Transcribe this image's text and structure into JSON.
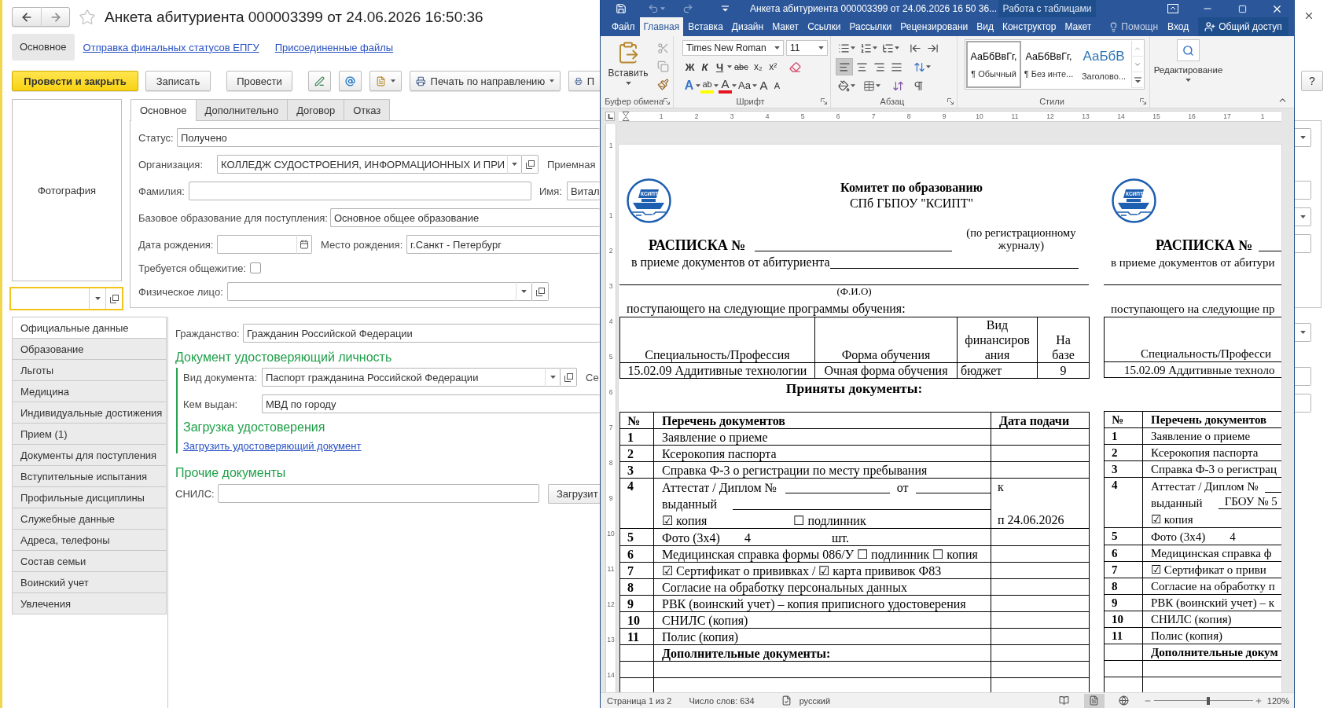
{
  "form": {
    "title": "Анкета абитуриента 000003399 от 24.06.2026 16:50:36",
    "sections": [
      {
        "label": "Основное",
        "selected": true
      },
      {
        "label": "Отправка финальных статусов ЕПГУ",
        "selected": false
      },
      {
        "label": "Присоединенные файлы",
        "selected": false
      }
    ],
    "toolbar": {
      "buttons": [
        {
          "kind": "primary",
          "label": "Провести и закрыть"
        },
        {
          "kind": "plain",
          "label": "Записать"
        },
        {
          "kind": "plain",
          "label": "Провести"
        }
      ],
      "print_buttons": [
        {
          "kind": "menu",
          "label": "Печать по направлению"
        },
        {
          "kind": "plain",
          "label": "П"
        }
      ]
    },
    "photo_label": "Фотография",
    "tabs": [
      {
        "label": "Основное",
        "selected": true
      },
      {
        "label": "Дополнительно",
        "selected": false
      },
      {
        "label": "Договор",
        "selected": false
      },
      {
        "label": "Отказ",
        "selected": false
      }
    ],
    "status": {
      "label": "Статус:",
      "value": "Получено"
    },
    "organization": {
      "label": "Организация:",
      "value": "КОЛЛЕДЖ СУДОСТРОЕНИЯ, ИНФОРМАЦИОННЫХ И ПРИ",
      "next_label": "Приемная"
    },
    "surname": {
      "label": "Фамилия:"
    },
    "first_name": {
      "label": "Имя:",
      "value": "Витал"
    },
    "base_education": {
      "label": "Базовое образование для поступления:",
      "value": "Основное общее образование"
    },
    "birth_date": {
      "label": "Дата рождения:"
    },
    "birth_place": {
      "label": "Место рождения:",
      "value": "г.Санкт - Петербург"
    },
    "dormitory": {
      "label": "Требуется общежитие:",
      "checked": false
    },
    "person": {
      "label": "Физическое лицо:"
    },
    "side_menu": [
      {
        "label": "Официальные данные",
        "selected": true
      },
      {
        "label": "Образование",
        "selected": false
      },
      {
        "label": "Льготы",
        "selected": false
      },
      {
        "label": "Медицина",
        "selected": false
      },
      {
        "label": "Индивидуальные достижения",
        "selected": false
      },
      {
        "label": "Прием (1)",
        "selected": false
      },
      {
        "label": "Документы для поступления",
        "selected": false
      },
      {
        "label": "Вступительные испытания",
        "selected": false
      },
      {
        "label": "Профильные дисциплины",
        "selected": false
      },
      {
        "label": "Служебные данные",
        "selected": false
      },
      {
        "label": "Адреса, телефоны",
        "selected": false
      },
      {
        "label": "Состав семьи",
        "selected": false
      },
      {
        "label": "Воинский учет",
        "selected": false
      },
      {
        "label": "Увлечения",
        "selected": false
      }
    ],
    "citizenship": {
      "label": "Гражданство:",
      "value": "Гражданин Российской Федерации"
    },
    "identity": {
      "title": "Документ удостоверяющий личность",
      "doc_type": {
        "label": "Вид документа:",
        "value": "Паспорт гражданина Российской Федерации",
        "next_label": "Се"
      },
      "issued_by": {
        "label": "Кем выдан:",
        "value": "МВД по городу"
      },
      "upload_title": "Загрузка удостоверения",
      "upload_link": "Загрузить удостоверяющий документ"
    },
    "other_docs": {
      "title": "Прочие документы",
      "snils_label": "СНИЛС:",
      "upload_button": "Загрузит"
    },
    "help_button": "?"
  },
  "word": {
    "title": "Анкета абитуриента 000003399 от 24.06.2026 16 50 36...",
    "context_title": "Работа с таблицами",
    "tabs": [
      {
        "label": "Файл",
        "selected": false
      },
      {
        "label": "Главная",
        "selected": true
      },
      {
        "label": "Вставка",
        "selected": false
      },
      {
        "label": "Дизайн",
        "selected": false
      },
      {
        "label": "Макет",
        "selected": false
      },
      {
        "label": "Ссылки",
        "selected": false
      },
      {
        "label": "Рассылки",
        "selected": false
      },
      {
        "label": "Рецензировани",
        "selected": false
      },
      {
        "label": "Вид",
        "selected": false
      },
      {
        "label": "Конструктор",
        "selected": false
      },
      {
        "label": "Макет",
        "selected": false
      }
    ],
    "help": "Помощн",
    "sign_in": "Вход",
    "share": "Общий доступ",
    "ribbon": {
      "clipboard": {
        "paste": "Вставить",
        "label": "Буфер обмена"
      },
      "font": {
        "name": "Times New Roman",
        "size": "11",
        "style_buttons": [
          "Ж",
          "К",
          "Ч",
          "abc",
          "x₂",
          "x²"
        ],
        "effect_buttons": [
          "A",
          "ab",
          "A",
          "Aa",
          "A",
          "A"
        ],
        "label": "Шрифт"
      },
      "paragraph": {
        "label": "Абзац",
        "alignments": [
          {
            "selected": true
          },
          {
            "selected": false
          },
          {
            "selected": false
          },
          {
            "selected": false
          }
        ]
      },
      "styles": {
        "label": "Стили",
        "items": [
          {
            "kind": "body",
            "sample": "АаБбВвГг,",
            "name": "¶ Обычный",
            "selected": true
          },
          {
            "kind": "body",
            "sample": "АаБбВвГг,",
            "name": "¶ Без инте...",
            "selected": false
          },
          {
            "kind": "heading",
            "sample": "АаБбВ",
            "name": "Заголово...",
            "selected": false
          }
        ]
      },
      "editing": {
        "label": "Редактирование"
      }
    },
    "ruler": [
      "1",
      "2",
      "3",
      "4",
      "5",
      "6",
      "7",
      "8",
      "9",
      "10",
      "11",
      "12",
      "13",
      "14",
      "15",
      "16",
      "17",
      "1"
    ],
    "vertical_ruler": [
      "1",
      "1",
      "2",
      "3",
      "4",
      "5",
      "6",
      "7",
      "8",
      "9",
      "10",
      "11",
      "12",
      "13",
      "14"
    ],
    "document": {
      "copies": [
        {
          "kind": "full",
          "logo_text": "КСИПТ",
          "org_lines": [
            "Комитет по образованию",
            "СПб ГБПОУ \"КСИПТ\""
          ],
          "receipt_title": "РАСПИСКА №",
          "register_note": "(по регистрационному журналу)",
          "from_label": "в приеме документов от абитуриента",
          "fio_hint": "(Ф.И.О)",
          "programs_intro": "поступающего на следующие программы обучения:",
          "programs": {
            "columns": [
              "Специальность/Профессия",
              "Форма обучения",
              "Вид финансирования",
              "На базе"
            ],
            "rows": [
              [
                "15.02.09 Аддитивные технологии",
                "Очная форма обучения",
                "бюджет",
                "9"
              ]
            ]
          },
          "accepted_title": "Приняты документы:",
          "documents": {
            "columns": [
              "№",
              "Перечень документов",
              "Дата подачи"
            ],
            "rows": [
              {
                "kind": "item",
                "number": "1",
                "text": "Заявление о приеме"
              },
              {
                "kind": "item",
                "number": "2",
                "text": "Ксерокопия паспорта"
              },
              {
                "kind": "item",
                "number": "3",
                "text": "Справка Ф-3 о регистрации по месту пребывания"
              },
              {
                "kind": "diploma",
                "number": "4",
                "title": "Аттестат / Диплом №",
                "date_label": "от",
                "issued_label": "выданный",
                "copy": "☑ копия",
                "original": "☐ подлинник",
                "date_top": "к",
                "date_bottom": "п 24.06.2026"
              },
              {
                "kind": "photo",
                "number": "5",
                "text": "Фото (3х4)",
                "count": "4",
                "unit": "шт."
              },
              {
                "kind": "item",
                "number": "6",
                "text": "Медицинская справка формы 086/У ☐ подлинник ☐ копия"
              },
              {
                "kind": "item",
                "number": "7",
                "text": "☑ Сертификат о прививках / ☑ карта прививок Ф83"
              },
              {
                "kind": "item",
                "number": "8",
                "text": "Согласие на обработку персональных данных"
              },
              {
                "kind": "item",
                "number": "9",
                "text": "РВК (воинский учет) – копия приписного удостоверения"
              },
              {
                "kind": "item",
                "number": "10",
                "text": "СНИЛС (копия)"
              },
              {
                "kind": "item",
                "number": "11",
                "text": "Полис (копия)"
              },
              {
                "kind": "section",
                "text": "Дополнительные документы:"
              },
              {
                "kind": "empty"
              },
              {
                "kind": "empty"
              }
            ]
          }
        },
        {
          "kind": "partial",
          "logo_text": "КСИПТ",
          "receipt_title": "РАСПИСКА №",
          "from_label": "в приеме документов от абитури",
          "programs_intro": "поступающего на следующие пр",
          "programs": {
            "columns": [
              "Специальность/Професси"
            ],
            "rows": [
              [
                "15.02.09 Аддитивные техноло"
              ]
            ]
          },
          "documents": {
            "columns": [
              "№",
              "Перечень документов"
            ],
            "rows": [
              {
                "kind": "item",
                "number": "1",
                "text": "Заявление о приеме"
              },
              {
                "kind": "item",
                "number": "2",
                "text": "Ксерокопия паспорта"
              },
              {
                "kind": "item",
                "number": "3",
                "text": "Справка Ф-3 о регистрац"
              },
              {
                "kind": "diploma",
                "number": "4",
                "title": "Аттестат / Диплом №",
                "issued_label": "выданный",
                "issued_value": "ГБОУ № 5",
                "copy": "☑ копия"
              },
              {
                "kind": "photo",
                "number": "5",
                "text": "Фото (3х4)",
                "count": "4"
              },
              {
                "kind": "item",
                "number": "6",
                "text": "Медицинская справка ф"
              },
              {
                "kind": "item",
                "number": "7",
                "text": "☑ Сертификат о приви"
              },
              {
                "kind": "item",
                "number": "8",
                "text": "Согласие на обработку п"
              },
              {
                "kind": "item",
                "number": "9",
                "text": "РВК (воинский учет) – к"
              },
              {
                "kind": "item",
                "number": "10",
                "text": "СНИЛС (копия)"
              },
              {
                "kind": "item",
                "number": "11",
                "text": "Полис (копия)"
              },
              {
                "kind": "section",
                "text": "Дополнительные докум"
              },
              {
                "kind": "empty"
              },
              {
                "kind": "empty"
              }
            ]
          }
        }
      ]
    },
    "status_bar": {
      "page": "Страница 1 из 2",
      "words": "Число слов: 634",
      "language": "русский",
      "views": [
        {
          "selected": false
        },
        {
          "selected": true
        },
        {
          "selected": false
        }
      ],
      "zoom_slider": {
        "level": 0.55
      },
      "zoom": "120%"
    }
  }
}
